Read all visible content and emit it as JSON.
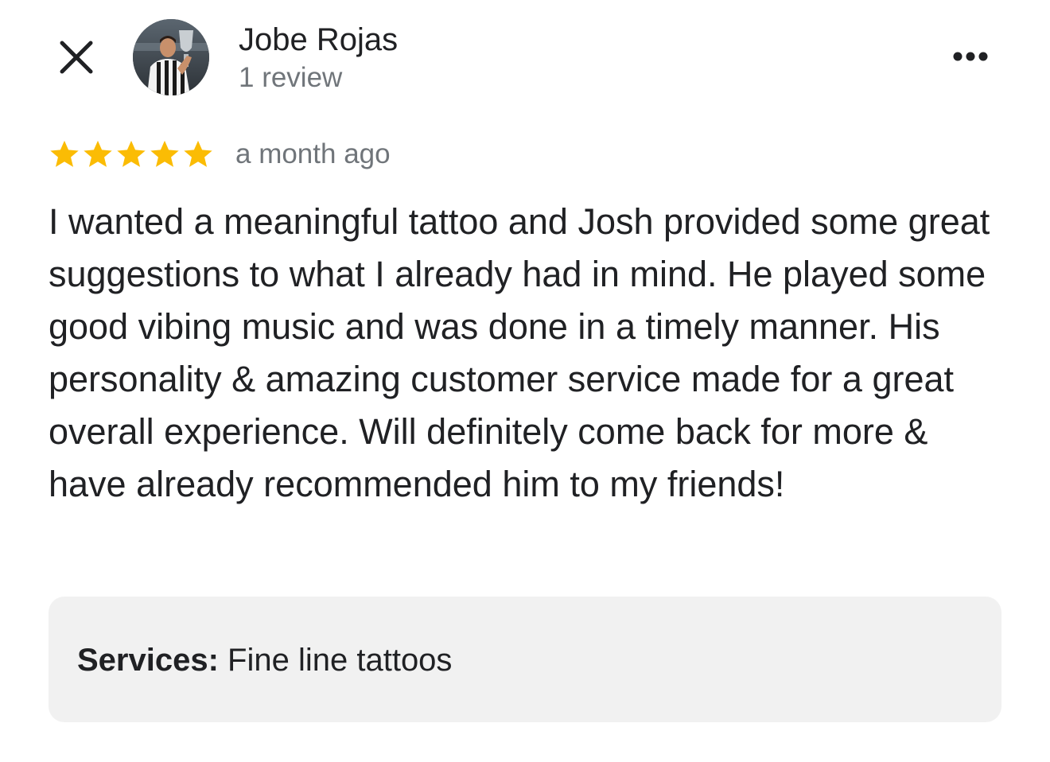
{
  "header": {
    "reviewer_name": "Jobe Rojas",
    "review_count": "1 review"
  },
  "icons": {
    "close": "close-icon",
    "more": "more-horizontal-icon",
    "star": "star-icon"
  },
  "review": {
    "rating": 5,
    "rating_max": 5,
    "date": "a month ago",
    "text": "I wanted a meaningful tattoo and Josh provided some great suggestions to what I already had in mind. He played some good vibing music and was done in a timely manner. His personality & amazing customer service made for a great overall experience. Will definitely come back for more & have already recommended him to my friends!"
  },
  "services": {
    "label": "Services:",
    "value": "Fine line tattoos"
  },
  "colors": {
    "star": "#FBBC04",
    "primary_text": "#202124",
    "secondary_text": "#70757a",
    "services_bg": "#f1f1f1"
  }
}
